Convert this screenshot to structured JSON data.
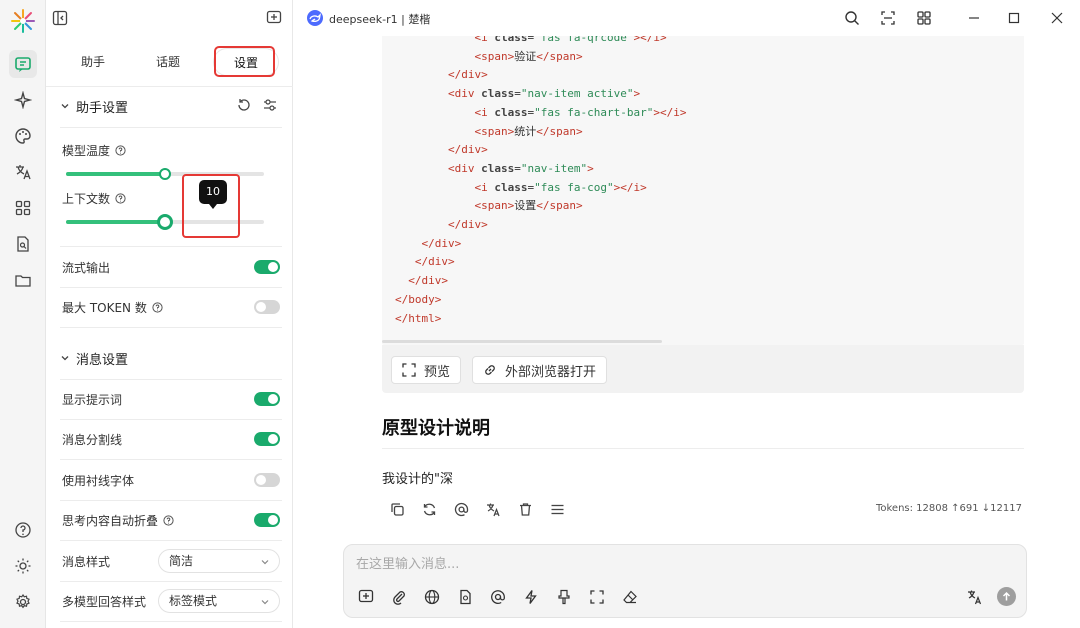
{
  "window": {
    "model_title": "deepseek-r1 | 楚楷"
  },
  "sidebar": {
    "tabs": [
      {
        "label": "助手"
      },
      {
        "label": "话题"
      },
      {
        "label": "设置"
      }
    ],
    "assistant_settings": {
      "title": "助手设置",
      "model_temperature_label": "模型温度",
      "context_count_label": "上下文数",
      "context_count_value": "10",
      "temperature_slider_fraction": 0.5,
      "context_slider_fraction": 0.5,
      "stream_output_label": "流式输出",
      "stream_output_on": true,
      "max_token_label": "最大 TOKEN 数",
      "max_token_on": false
    },
    "message_settings": {
      "title": "消息设置",
      "show_prompt_label": "显示提示词",
      "show_prompt_on": true,
      "divider_label": "消息分割线",
      "divider_on": true,
      "serif_font_label": "使用衬线字体",
      "serif_font_on": false,
      "auto_fold_label": "思考内容自动折叠",
      "auto_fold_on": true,
      "message_style_label": "消息样式",
      "message_style_value": "简洁",
      "multi_model_label": "多模型回答样式",
      "multi_model_value": "标签模式"
    }
  },
  "code_lines": [
    {
      "indent": "            ",
      "parts": [
        [
          "tag",
          "<i "
        ],
        [
          "attr",
          "class"
        ],
        [
          "txt",
          "="
        ],
        [
          "str",
          "\"fas fa-qrcode\""
        ],
        [
          "tag",
          ">"
        ],
        [
          "tag",
          "</i>"
        ]
      ]
    },
    {
      "indent": "            ",
      "parts": [
        [
          "tag",
          "<span"
        ],
        [
          "tag",
          ">"
        ],
        [
          "txt",
          "验证"
        ],
        [
          "tag",
          "</span>"
        ]
      ]
    },
    {
      "indent": "        ",
      "parts": [
        [
          "tag",
          "</div>"
        ]
      ]
    },
    {
      "indent": "        ",
      "parts": [
        [
          "tag",
          "<div "
        ],
        [
          "attr",
          "class"
        ],
        [
          "txt",
          "="
        ],
        [
          "str",
          "\"nav-item active\""
        ],
        [
          "tag",
          ">"
        ]
      ]
    },
    {
      "indent": "            ",
      "parts": [
        [
          "tag",
          "<i "
        ],
        [
          "attr",
          "class"
        ],
        [
          "txt",
          "="
        ],
        [
          "str",
          "\"fas fa-chart-bar\""
        ],
        [
          "tag",
          ">"
        ],
        [
          "tag",
          "</i>"
        ]
      ]
    },
    {
      "indent": "            ",
      "parts": [
        [
          "tag",
          "<span"
        ],
        [
          "tag",
          ">"
        ],
        [
          "txt",
          "统计"
        ],
        [
          "tag",
          "</span>"
        ]
      ]
    },
    {
      "indent": "        ",
      "parts": [
        [
          "tag",
          "</div>"
        ]
      ]
    },
    {
      "indent": "        ",
      "parts": [
        [
          "tag",
          "<div "
        ],
        [
          "attr",
          "class"
        ],
        [
          "txt",
          "="
        ],
        [
          "str",
          "\"nav-item\""
        ],
        [
          "tag",
          ">"
        ]
      ]
    },
    {
      "indent": "            ",
      "parts": [
        [
          "tag",
          "<i "
        ],
        [
          "attr",
          "class"
        ],
        [
          "txt",
          "="
        ],
        [
          "str",
          "\"fas fa-cog\""
        ],
        [
          "tag",
          ">"
        ],
        [
          "tag",
          "</i>"
        ]
      ]
    },
    {
      "indent": "            ",
      "parts": [
        [
          "tag",
          "<span"
        ],
        [
          "tag",
          ">"
        ],
        [
          "txt",
          "设置"
        ],
        [
          "tag",
          "</span>"
        ]
      ]
    },
    {
      "indent": "        ",
      "parts": [
        [
          "tag",
          "</div>"
        ]
      ]
    },
    {
      "indent": "    ",
      "parts": [
        [
          "tag",
          "</div>"
        ]
      ]
    },
    {
      "indent": "   ",
      "parts": [
        [
          "tag",
          "</div>"
        ]
      ]
    },
    {
      "indent": "  ",
      "parts": [
        [
          "tag",
          "</div>"
        ]
      ]
    },
    {
      "indent": "",
      "parts": [
        [
          "tag",
          "</body>"
        ]
      ]
    },
    {
      "indent": "",
      "parts": [
        [
          "tag",
          "</html>"
        ]
      ]
    }
  ],
  "code_actions": {
    "preview_label": "预览",
    "open_browser_label": "外部浏览器打开"
  },
  "message": {
    "heading": "原型设计说明",
    "paragraph": "我设计的\"深",
    "tokens": "Tokens: 12808 ↑691 ↓12117"
  },
  "composer": {
    "placeholder": "在这里输入消息..."
  },
  "colors": {
    "accent_green": "#1aaa6c",
    "highlight_red": "#e53935",
    "deepseek_blue": "#4d6bfe"
  }
}
